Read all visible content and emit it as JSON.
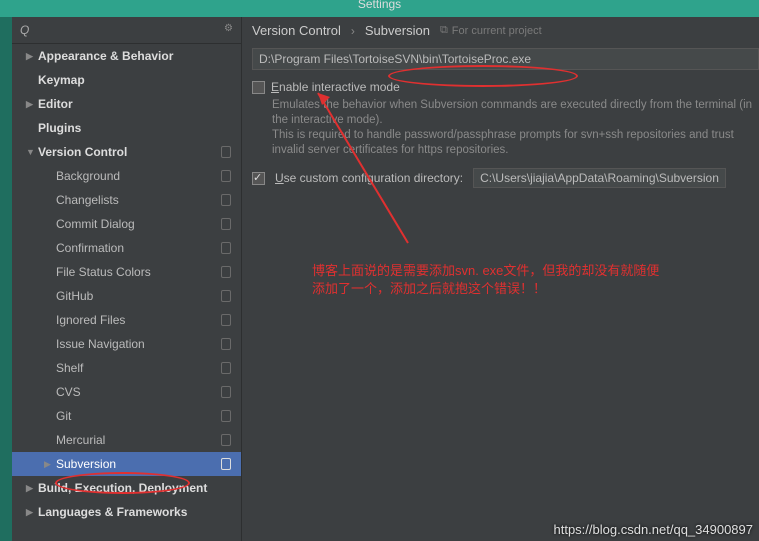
{
  "title": "Settings",
  "search": {
    "placeholder": ""
  },
  "breadcrumb": {
    "a": "Version Control",
    "sep": "›",
    "b": "Subversion",
    "project": "For current project"
  },
  "sidebar": {
    "items": [
      {
        "label": "Appearance & Behavior",
        "bold": true,
        "level": 1,
        "arrow": "▶"
      },
      {
        "label": "Keymap",
        "bold": true,
        "level": 1
      },
      {
        "label": "Editor",
        "bold": true,
        "level": 1,
        "arrow": "▶"
      },
      {
        "label": "Plugins",
        "bold": true,
        "level": 1
      },
      {
        "label": "Version Control",
        "bold": true,
        "level": 1,
        "arrow": "▼",
        "pill": true
      },
      {
        "label": "Background",
        "level": 2,
        "pill": true
      },
      {
        "label": "Changelists",
        "level": 2,
        "pill": true
      },
      {
        "label": "Commit Dialog",
        "level": 2,
        "pill": true
      },
      {
        "label": "Confirmation",
        "level": 2,
        "pill": true
      },
      {
        "label": "File Status Colors",
        "level": 2,
        "pill": true
      },
      {
        "label": "GitHub",
        "level": 2,
        "pill": true
      },
      {
        "label": "Ignored Files",
        "level": 2,
        "pill": true
      },
      {
        "label": "Issue Navigation",
        "level": 2,
        "pill": true
      },
      {
        "label": "Shelf",
        "level": 2,
        "pill": true
      },
      {
        "label": "CVS",
        "level": 2,
        "pill": true
      },
      {
        "label": "Git",
        "level": 2,
        "pill": true
      },
      {
        "label": "Mercurial",
        "level": 2,
        "pill": true
      },
      {
        "label": "Subversion",
        "level": 2,
        "arrow": "▶",
        "pill": true,
        "selected": true
      },
      {
        "label": "Build, Execution, Deployment",
        "bold": true,
        "level": 1,
        "arrow": "▶"
      },
      {
        "label": "Languages & Frameworks",
        "bold": true,
        "level": 1,
        "arrow": "▶"
      }
    ]
  },
  "form": {
    "path": "D:\\Program Files\\TortoiseSVN\\bin\\TortoiseProc.exe",
    "enable_label_pre": "E",
    "enable_label": "nable interactive mode",
    "help1": "Emulates the behavior when Subversion commands are executed directly from the terminal (in the interactive mode).",
    "help2": "This is required to handle password/passphrase prompts for svn+ssh repositories and trust invalid server certificates for https repositories.",
    "custom_pre": "U",
    "custom_label": "se custom configuration directory:",
    "custom_path": "C:\\Users\\jiajia\\AppData\\Roaming\\Subversion"
  },
  "annotation": {
    "text1": "博客上面说的是需要添加svn. exe文件，但我的却没有就随便",
    "text2": "添加了一个，添加之后就抱这个错误！！"
  },
  "watermark": "https://blog.csdn.net/qq_34900897"
}
